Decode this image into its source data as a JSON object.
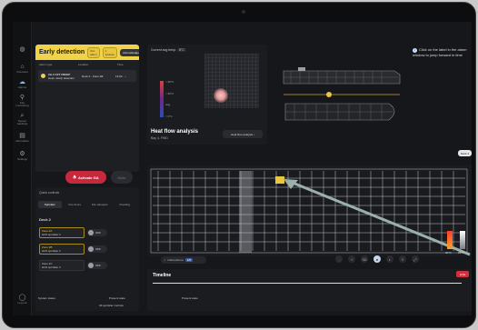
{
  "sidebar": {
    "items": [
      {
        "icon": "globe-icon",
        "label": "Home"
      },
      {
        "icon": "home-icon",
        "label": "Overview"
      },
      {
        "icon": "cloud-icon",
        "label": "Alarms"
      },
      {
        "icon": "pin-icon",
        "label": "Fire monitoring"
      },
      {
        "icon": "search-icon",
        "label": "Sensor readings"
      },
      {
        "icon": "doc-icon",
        "label": "Information"
      },
      {
        "icon": "gear-icon",
        "label": "Settings"
      },
      {
        "icon": "user-icon",
        "label": "Log out"
      }
    ]
  },
  "early_detection": {
    "title": "Early detection",
    "badges": [
      "Fire alarm",
      "1 location"
    ],
    "badge_right": "Acknowledge",
    "columns": [
      "Alarm type",
      "Location",
      "Time"
    ],
    "row": {
      "name": "CH 2 AFT FREEP",
      "detail": "Heat • Early detection",
      "location": "Deck 2 - Zone 2B",
      "time": "13:04"
    }
  },
  "actions": {
    "activate": "Activate GA",
    "mute": "Mute"
  },
  "quick": {
    "title": "Quick controls",
    "tabs": [
      "Sprinkler",
      "Fire doors",
      "Fire dampers",
      "Flooding"
    ],
    "deck": "Deck 2",
    "zones": [
      {
        "name": "Zone 2A",
        "sub": "H2O sprinkler 1",
        "state": "OFF"
      },
      {
        "name": "Zone 2B",
        "sub": "H2O sprinkler 1",
        "state": "OFF"
      },
      {
        "name": "Zone 2C",
        "sub": "H2O sprinkler 1",
        "state": "OFF"
      }
    ],
    "all": "All sprinkler controls"
  },
  "heat": {
    "label": "Current avg temp.",
    "value": "8°C",
    "scale": [
      "> 90°C",
      "< 60°C",
      "Avg",
      "< 0°C"
    ],
    "title": "Heat flow analysis",
    "sub": "Bay 4, FWD",
    "button": "Heat flow analysis"
  },
  "tip": {
    "icon": "i",
    "text": "Click on the label in the alarm window to jump forward in time"
  },
  "deck_btn": "Deck 2",
  "init": {
    "label": "Initial actions",
    "badge": "1/5"
  },
  "controls": [
    "-",
    "+",
    "3D",
    "●",
    "◐",
    "≡",
    "⤢"
  ],
  "temps": {
    "high": "30°C",
    "low": "25°C"
  },
  "timeline": {
    "title": "Timeline",
    "live": "LIVE"
  },
  "footer": [
    "System status",
    "Present state",
    "Present state"
  ]
}
